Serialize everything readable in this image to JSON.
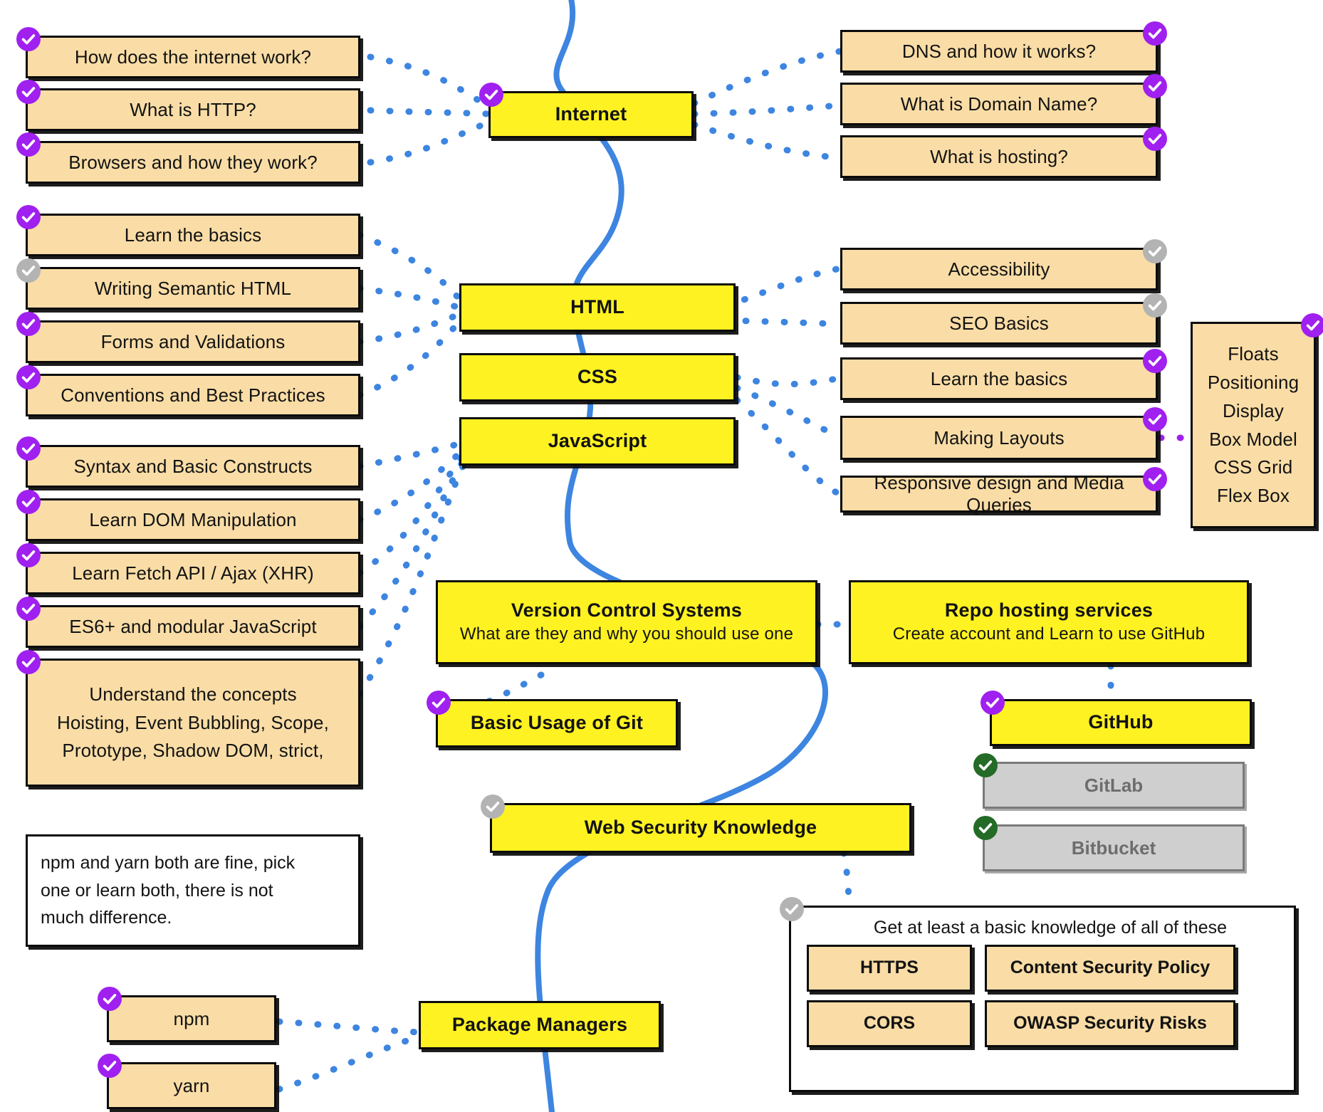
{
  "theme": {
    "primary_fill": "#fff222",
    "topic_fill": "#fadda6",
    "muted_fill": "#cfcfcf",
    "edge_color": "#3d85e0",
    "badge_done": "#a020f0",
    "badge_undone": "#b3b3b3",
    "badge_alt": "#236b26",
    "border": "#0b0b0b"
  },
  "spine": [
    {
      "label": "Internet",
      "status": "done"
    },
    {
      "label": "HTML",
      "status": "none"
    },
    {
      "label": "CSS",
      "status": "none"
    },
    {
      "label": "JavaScript",
      "status": "none"
    }
  ],
  "internet": {
    "left": [
      {
        "label": "How does the internet work?",
        "status": "done"
      },
      {
        "label": "What is HTTP?",
        "status": "done"
      },
      {
        "label": "Browsers and how they work?",
        "status": "done"
      }
    ],
    "right": [
      {
        "label": "DNS and how it works?",
        "status": "done"
      },
      {
        "label": "What is Domain Name?",
        "status": "done"
      },
      {
        "label": "What is hosting?",
        "status": "done"
      }
    ]
  },
  "html": {
    "left": [
      {
        "label": "Learn the basics",
        "status": "done"
      },
      {
        "label": "Writing Semantic HTML",
        "status": "undone"
      },
      {
        "label": "Forms and Validations",
        "status": "done"
      },
      {
        "label": "Conventions and Best Practices",
        "status": "done"
      }
    ],
    "right": [
      {
        "label": "Accessibility",
        "status": "undone"
      },
      {
        "label": "SEO Basics",
        "status": "undone"
      }
    ]
  },
  "css": {
    "right": [
      {
        "label": "Learn the basics",
        "status": "done"
      },
      {
        "label": "Making Layouts",
        "status": "done"
      },
      {
        "label": "Responsive design and Media Queries",
        "status": "done",
        "small": true
      }
    ],
    "concepts": {
      "status": "done",
      "items": [
        "Floats",
        "Positioning",
        "Display",
        "Box Model",
        "CSS Grid",
        "Flex Box"
      ]
    }
  },
  "javascript": {
    "left": [
      {
        "label": "Syntax and Basic Constructs",
        "status": "done"
      },
      {
        "label": "Learn DOM Manipulation",
        "status": "done"
      },
      {
        "label": "Learn Fetch API / Ajax (XHR)",
        "status": "done"
      },
      {
        "label": "ES6+ and modular  JavaScript",
        "status": "done"
      }
    ],
    "concepts": {
      "status": "done",
      "lines": [
        "Understand the concepts",
        "Hoisting, Event Bubbling, Scope,",
        "Prototype, Shadow DOM, strict,"
      ]
    }
  },
  "version_control": {
    "title": "Version Control Systems",
    "subtitle": "What are they and why you should use one",
    "git": {
      "label": "Basic Usage of Git",
      "status": "done"
    }
  },
  "repo_hosting": {
    "title": "Repo hosting services",
    "subtitle": "Create account and Learn to use GitHub",
    "services": [
      {
        "label": "GitHub",
        "status": "done",
        "style": "primary"
      },
      {
        "label": "GitLab",
        "status": "alt",
        "style": "muted"
      },
      {
        "label": "Bitbucket",
        "status": "alt",
        "style": "muted"
      }
    ]
  },
  "web_security": {
    "title": "Web Security Knowledge",
    "status": "undone",
    "group": {
      "status": "undone",
      "heading": "Get at least a basic knowledge of all of these",
      "items": [
        "HTTPS",
        "Content Security Policy",
        "CORS",
        "OWASP Security Risks"
      ]
    }
  },
  "package_managers": {
    "title": "Package Managers",
    "note": [
      "npm and yarn both are fine, pick",
      "one or learn both, there is not",
      "much difference."
    ],
    "tools": [
      {
        "label": "npm",
        "status": "done"
      },
      {
        "label": "yarn",
        "status": "done"
      }
    ]
  }
}
